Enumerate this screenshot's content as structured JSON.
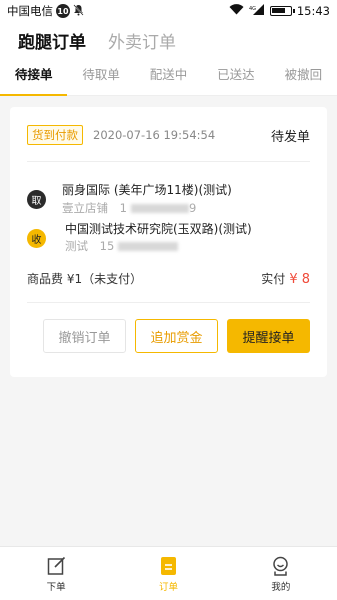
{
  "status_bar": {
    "carrier": "中国电信",
    "notif_count": "10",
    "network": "4G",
    "battery_pct": 80,
    "time": "15:43"
  },
  "top_tabs": [
    {
      "label": "跑腿订单",
      "active": true
    },
    {
      "label": "外卖订单",
      "active": false
    }
  ],
  "sub_tabs": [
    {
      "label": "待接单",
      "active": true
    },
    {
      "label": "待取单",
      "active": false
    },
    {
      "label": "配送中",
      "active": false
    },
    {
      "label": "已送达",
      "active": false
    },
    {
      "label": "被撤回",
      "active": false
    }
  ],
  "order": {
    "payment_tag": "货到付款",
    "time": "2020-07-16 19:54:54",
    "status": "待发单",
    "pickup": {
      "badge": "取",
      "name": "丽身国际 (美年广场11楼)(测试)",
      "contact": "壹立店铺",
      "phone_prefix": "1",
      "phone_suffix": "9"
    },
    "receiver": {
      "badge": "收",
      "name": "中国测试技术研究院(玉双路)(测试)",
      "contact": "测试",
      "phone_prefix": "15"
    },
    "fee_text": "商品费 ¥1（未支付）",
    "paid_label": "实付",
    "paid_amount": "¥ 8",
    "buttons": {
      "cancel": "撤销订单",
      "bonus": "追加赏金",
      "remind": "提醒接单"
    }
  },
  "bottom_nav": [
    {
      "label": "下单",
      "icon": "edit-icon",
      "active": false
    },
    {
      "label": "订单",
      "icon": "order-icon",
      "active": true
    },
    {
      "label": "我的",
      "icon": "profile-icon",
      "active": false
    }
  ],
  "colors": {
    "accent": "#f5b800",
    "price": "#f04b3a"
  }
}
